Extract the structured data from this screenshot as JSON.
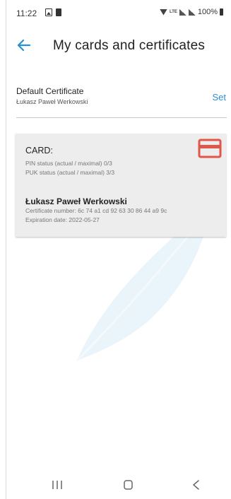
{
  "status_bar": {
    "time": "11:22",
    "battery_percent": "100%",
    "lte_label": "LTE"
  },
  "app_bar": {
    "title": "My cards and certificates",
    "back_icon": "arrow-left-icon"
  },
  "default_certificate": {
    "title": "Default Certificate",
    "owner": "Łukasz Paweł Werkowski",
    "set_label": "Set"
  },
  "card": {
    "label": "CARD:",
    "icon": "credit-card-icon",
    "icon_color": "#e0574a",
    "pin_status": "PIN status (actual / maximal) 0/3",
    "puk_status": "PUK status (actual / maximal) 3/3",
    "holder_name": "Łukasz Paweł Werkowski",
    "certificate_number": "Certificate number: 6c 74 a1 cd 92 63 30 86 44 a9 9c",
    "expiration_date": "Expiration date: 2022-05-27"
  },
  "colors": {
    "accent": "#2a8fd6",
    "panel_bg": "#ededed",
    "watermark": "#eaf4fb"
  },
  "nav_bar": {
    "recent_icon": "recent-apps-icon",
    "home_icon": "home-icon",
    "back_icon": "back-icon"
  }
}
